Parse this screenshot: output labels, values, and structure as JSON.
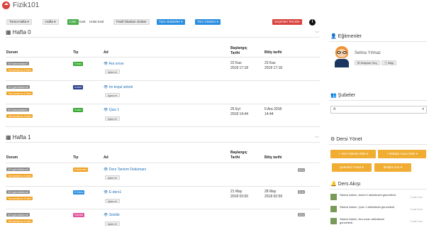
{
  "header": {
    "title": "Fizik101"
  },
  "toolbar": {
    "all_weeks": "Tümü-Hafta",
    "week": "Hafta",
    "list": "Liste",
    "card": "Kart",
    "unit_card": "Unite Kart",
    "show_passive": "Pasif Olanları Göster",
    "all_activities": "Tüm Aktiviteler",
    "all_units": "Tüm Üniteler",
    "clear_selection": "Seçimleri Temizle"
  },
  "weeks": [
    {
      "title": "Hafta 0",
      "columns": {
        "status": "Durum",
        "type": "Tip",
        "name": "Ad",
        "start": "Başlangıç Tarihi",
        "end": "Bitiş tarihi"
      },
      "rows": [
        {
          "status": "0/3 tamamlandı",
          "status2": "Tamamlama Kriteri",
          "type": "Sınav",
          "type_color": "#3aaa35",
          "name": "Ara sınav",
          "start": "22 Kas 2018 17:18",
          "end": "23 Kas 2018 17:18",
          "ops": "İşlem"
        },
        {
          "status": "0/3 görüntülendi",
          "status2": "Tamamlama Kriteri",
          "type": "Anket",
          "type_color": "#2a3f8a",
          "name": "ön koşul anketi",
          "start": "",
          "end": "",
          "ops": "İşlem"
        },
        {
          "status": "0/3 tamamlandı",
          "status2": "Tamamlama Kriteri",
          "type": "Sınav",
          "type_color": "#3aaa35",
          "name": "Quiz 1",
          "start": "25 Eyl 2018 14:44",
          "end": "6 Ara 2018 14:44",
          "ops": "İşlem"
        }
      ]
    },
    {
      "title": "Hafta 1",
      "columns": {
        "status": "Durum",
        "type": "Tip",
        "name": "Ad",
        "start": "Başlangıç Tarihi",
        "end": "Bitiş tarihi"
      },
      "rows": [
        {
          "status": "0/3 görüntülendi",
          "status2": "Tamamlama Kriteri",
          "type": "Doküman",
          "type_color": "#f0a020",
          "name": "Ders Tanıtım Dokümanı",
          "start": "",
          "end": "",
          "ops": "İşlem",
          "h": "H 1"
        },
        {
          "status": "0/3 görüntülendi",
          "status2": "Tamamlama Kriteri",
          "type": "E-Ders",
          "type_color": "#2c8ee0",
          "name": "E-ders1",
          "start": "21 May 2018 03:00",
          "end": "28 May 2018 02:59",
          "ops": "İşlem",
          "h": "H 1"
        },
        {
          "status": "0/3 görüntülendi",
          "status2": "Tamamlama Kriteri",
          "type": "Sözlük",
          "type_color": "#e0529a",
          "name": "Sözlük",
          "start": "",
          "end": "",
          "ops": "İşlem",
          "h": "H 1"
        }
      ]
    }
  ],
  "sidebar": {
    "instructors": {
      "title": "Eğitmenler",
      "name": "Selma Yılmaz",
      "contact": "İletişime Geç",
      "info": "Bilgi"
    },
    "branches": {
      "title": "Şubeler",
      "selected": "A"
    },
    "manage": {
      "title": "Dersi Yönet",
      "new_activity": "Yeni Aktivite Ekle",
      "new_tool": "İletişim Aracı Ekle",
      "manage_branches": "Şubeleri Yönet",
      "communication": "İletişim Kur"
    },
    "feed": {
      "title": "Ders Akışı",
      "items": [
        {
          "text": "Sistem Admin, Anket 2 aktivitesini güncelledi.",
          "time": "2 saat önce"
        },
        {
          "text": "Sistem Admin, Quiz 1 aktivitesini güncelledi.",
          "time": "2 saat önce"
        },
        {
          "text": "Sistem Admin, Ara sınav aktivitesini güncelledi.",
          "time": "2 saat önce"
        }
      ]
    }
  },
  "colors": {
    "header_bg": "#d9433d",
    "accent": "#2c8ee0",
    "orange": "#f0ad31"
  }
}
